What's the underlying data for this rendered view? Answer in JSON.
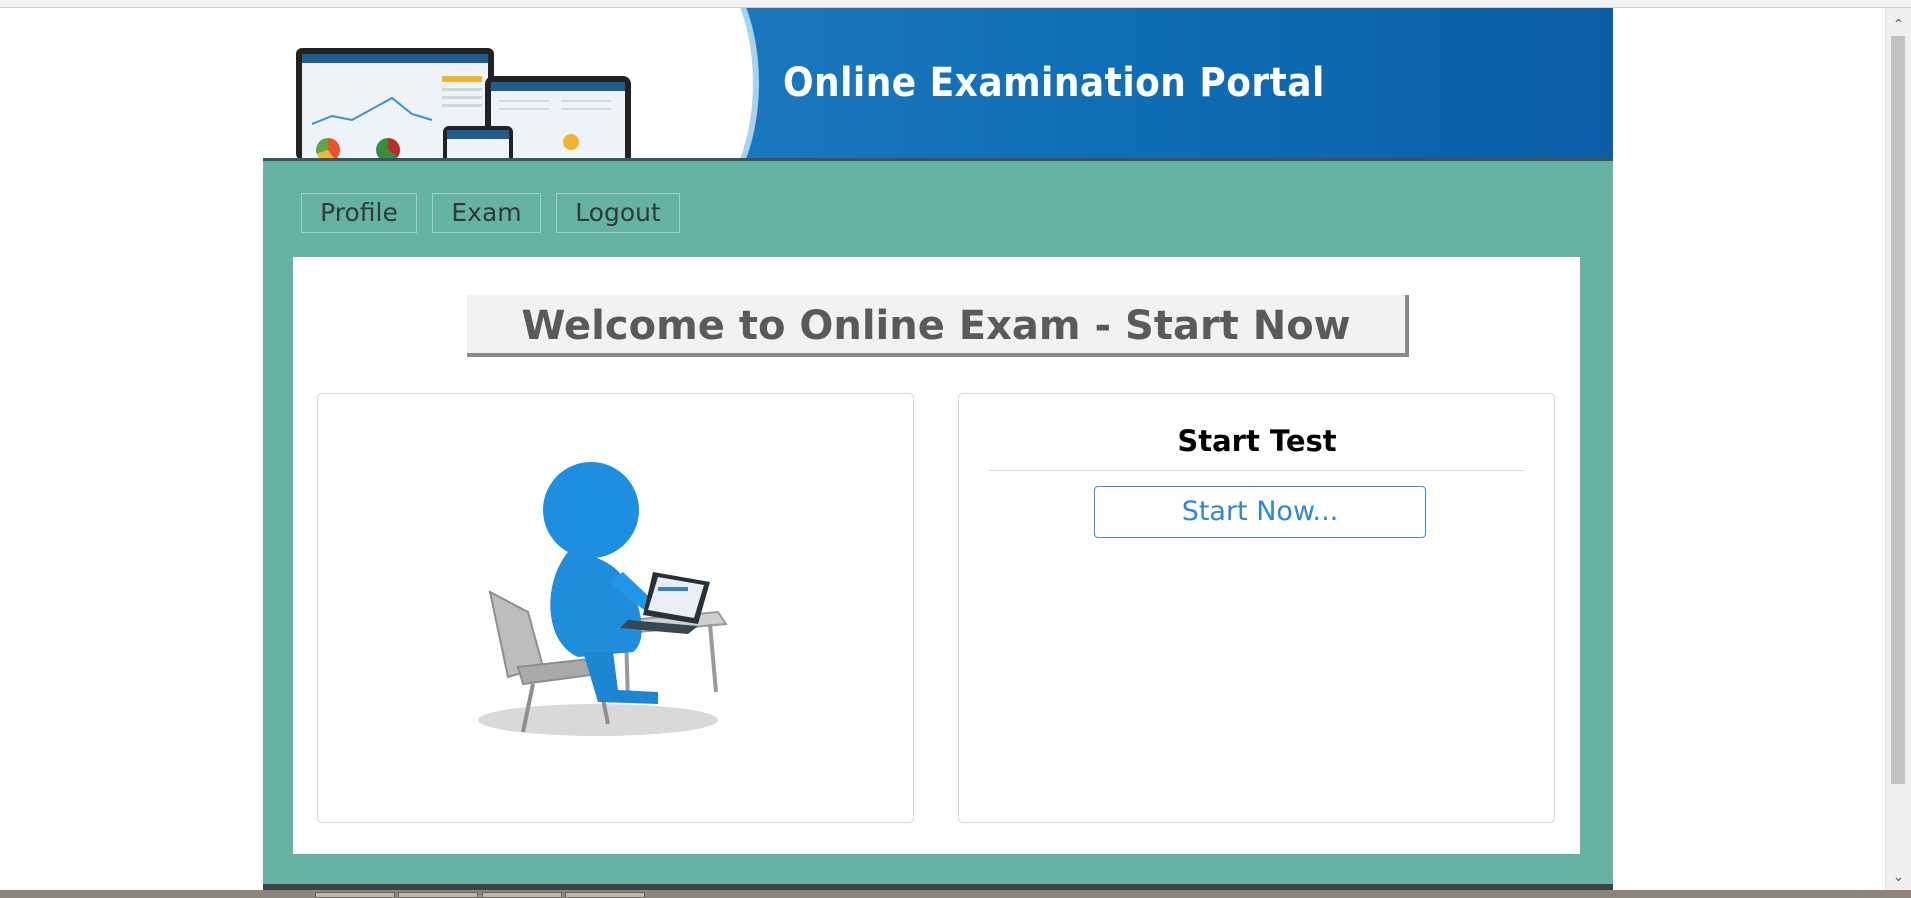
{
  "banner": {
    "title": "Online Examination Portal",
    "brand_color": "#0f6db5"
  },
  "nav": {
    "items": [
      {
        "label": "Profile"
      },
      {
        "label": "Exam"
      },
      {
        "label": "Logout"
      }
    ]
  },
  "main": {
    "welcome_heading": "Welcome to Online Exam - Start Now",
    "start_panel": {
      "title": "Start Test",
      "button_label": "Start Now..."
    }
  },
  "colors": {
    "page_background": "#66b3a6",
    "button_accent": "#2f86d9"
  },
  "icons": {
    "illustration": "person-at-laptop-illustration",
    "scroll_up": "chevron-up-icon",
    "scroll_down": "chevron-down-icon"
  }
}
